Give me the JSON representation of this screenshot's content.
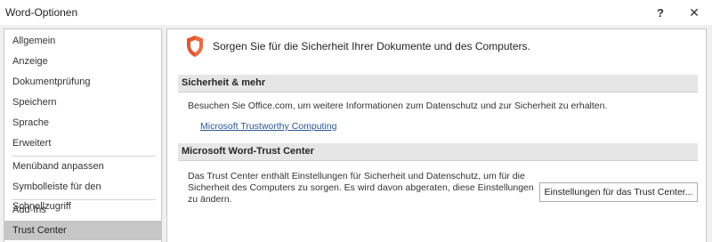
{
  "window": {
    "title": "Word-Optionen",
    "help_glyph": "?",
    "close_glyph": "✕"
  },
  "sidebar": {
    "items": [
      {
        "label": "Allgemein"
      },
      {
        "label": "Anzeige"
      },
      {
        "label": "Dokumentprüfung"
      },
      {
        "label": "Speichern"
      },
      {
        "label": "Sprache"
      },
      {
        "label": "Erweitert"
      },
      {
        "label": "Menüband anpassen"
      },
      {
        "label": "Symbolleiste für den Schnellzugriff"
      },
      {
        "label": "Add-Ins"
      },
      {
        "label": "Trust Center",
        "selected": true
      }
    ]
  },
  "main": {
    "icon": "shield-icon",
    "intro_text": "Sorgen Sie für die Sicherheit Ihrer Dokumente und des Computers.",
    "security_section": {
      "heading": "Sicherheit & mehr",
      "description": "Besuchen Sie Office.com, um weitere Informationen zum Datenschutz und zur Sicherheit zu erhalten.",
      "link_text": "Microsoft Trustworthy Computing"
    },
    "trust_center_section": {
      "heading": "Microsoft Word-Trust Center",
      "description": "Das Trust Center enthält Einstellungen für Sicherheit und Datenschutz, um für die Sicherheit des Computers zu sorgen. Es wird davon abgeraten, diese Einstellungen zu ändern.",
      "button_label": "Einstellungen für das Trust Center..."
    }
  },
  "colors": {
    "accent_link": "#2b579a",
    "shield_orange": "#e8542a",
    "selected_item": "#c6c6c6"
  }
}
